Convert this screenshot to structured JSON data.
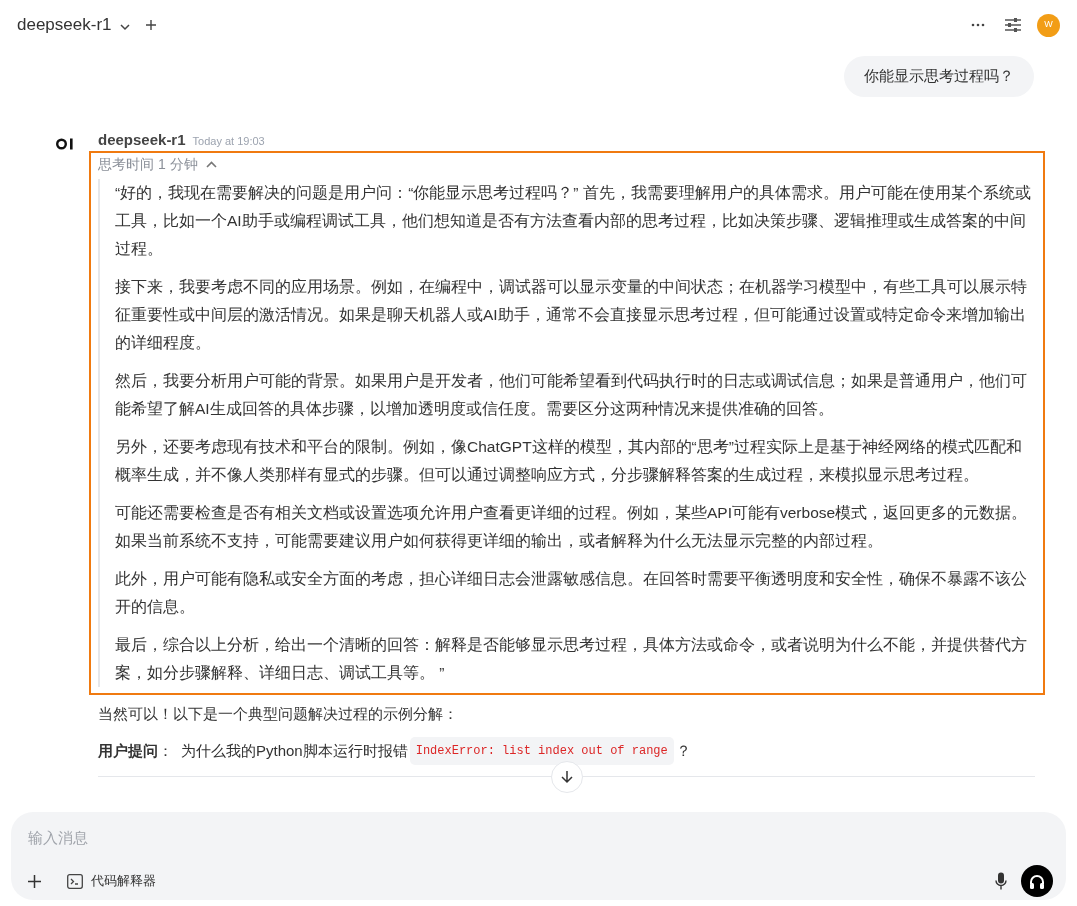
{
  "header": {
    "model": "deepseek-r1",
    "avatar": "W"
  },
  "user_message": "你能显示思考过程吗？",
  "assistant": {
    "name": "deepseek-r1",
    "time": "Today at 19:03",
    "thinking": {
      "label": "思考时间 1 分钟",
      "expanded": true,
      "paragraphs": [
        "“好的，我现在需要解决的问题是用户问：“你能显示思考过程吗？” 首先，我需要理解用户的具体需求。用户可能在使用某个系统或工具，比如一个AI助手或编程调试工具，他们想知道是否有方法查看内部的思考过程，比如决策步骤、逻辑推理或生成答案的中间过程。",
        "接下来，我要考虑不同的应用场景。例如，在编程中，调试器可以显示变量的中间状态；在机器学习模型中，有些工具可以展示特征重要性或中间层的激活情况。如果是聊天机器人或AI助手，通常不会直接显示思考过程，但可能通过设置或特定命令来增加输出的详细程度。",
        "然后，我要分析用户可能的背景。如果用户是开发者，他们可能希望看到代码执行时的日志或调试信息；如果是普通用户，他们可能希望了解AI生成回答的具体步骤，以增加透明度或信任度。需要区分这两种情况来提供准确的回答。",
        "另外，还要考虑现有技术和平台的限制。例如，像ChatGPT这样的模型，其内部的“思考”过程实际上是基于神经网络的模式匹配和概率生成，并不像人类那样有显式的步骤。但可以通过调整响应方式，分步骤解释答案的生成过程，来模拟显示思考过程。",
        "可能还需要检查是否有相关文档或设置选项允许用户查看更详细的过程。例如，某些API可能有verbose模式，返回更多的元数据。如果当前系统不支持，可能需要建议用户如何获得更详细的输出，或者解释为什么无法显示完整的内部过程。",
        "此外，用户可能有隐私或安全方面的考虑，担心详细日志会泄露敏感信息。在回答时需要平衡透明度和安全性，确保不暴露不该公开的信息。",
        "最后，综合以上分析，给出一个清晰的回答：解释是否能够显示思考过程，具体方法或命令，或者说明为什么不能，并提供替代方案，如分步骤解释、详细日志、调试工具等。 ”"
      ]
    },
    "answer": "当然可以！以下是一个典型问题解决过程的示例分解：",
    "question": {
      "label": "用户提问",
      "colon": "：",
      "text": "为什么我的Python脚本运行时报错",
      "code": "IndexError: list index out of range",
      "end": "？"
    }
  },
  "composer": {
    "placeholder": "输入消息",
    "tool": "代码解释器"
  }
}
